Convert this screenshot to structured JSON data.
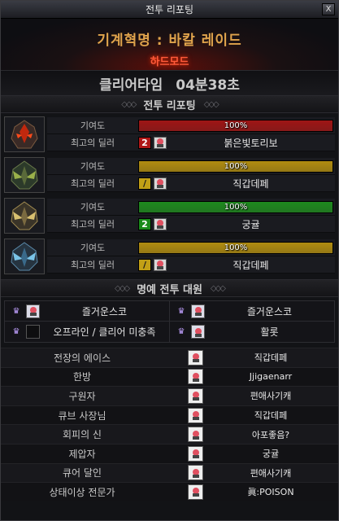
{
  "window": {
    "title": "전투 리포팅",
    "close_label": "X"
  },
  "raid": {
    "name": "기계혁명 : 바칼 레이드",
    "mode": "하드모드"
  },
  "clear_time": {
    "label": "클리어타임",
    "value": "04분38초"
  },
  "report_section": {
    "title": "전투 리포팅"
  },
  "reports": [
    {
      "portrait": "flame-mask-icon",
      "contribution_label": "기여도",
      "contribution_text": "100%",
      "contribution": 1.0,
      "bar_color": "#9e1515",
      "dealer_label": "최고의 딜러",
      "rank": "2",
      "rank_color": "#b01818",
      "rank_text_color": "#ffffff",
      "dealer_name": "붉은빛토리보"
    },
    {
      "portrait": "green-mask-icon",
      "contribution_label": "기여도",
      "contribution_text": "100%",
      "contribution": 1.0,
      "bar_color": "#b08c10",
      "dealer_label": "최고의 딜러",
      "rank": "/",
      "rank_color": "#c2a016",
      "rank_text_color": "#1a1a1a",
      "dealer_name": "직갑데페"
    },
    {
      "portrait": "gold-mask-icon",
      "contribution_label": "기여도",
      "contribution_text": "100%",
      "contribution": 1.0,
      "bar_color": "#1e8a1e",
      "dealer_label": "최고의 딜러",
      "rank": "2",
      "rank_color": "#1a8a1a",
      "rank_text_color": "#ffffff",
      "dealer_name": "궁귤"
    },
    {
      "portrait": "ice-mask-icon",
      "contribution_label": "기여도",
      "contribution_text": "100%",
      "contribution": 1.0,
      "bar_color": "#b08c10",
      "dealer_label": "최고의 딜러",
      "rank": "/",
      "rank_color": "#c2a016",
      "rank_text_color": "#1a1a1a",
      "dealer_name": "직갑데페"
    }
  ],
  "honor_section": {
    "title": "명예 전투 대원"
  },
  "honor": [
    [
      {
        "name": "즐거운스코",
        "empty": false
      },
      {
        "name": "즐거운스코",
        "empty": false
      }
    ],
    [
      {
        "name": "오프라인 / 클리어 미충족",
        "empty": true
      },
      {
        "name": "활롯",
        "empty": false
      }
    ]
  ],
  "awards": [
    {
      "title": "전장의 에이스",
      "name": "직갑데페"
    },
    {
      "title": "한방",
      "name": "Jjigaenarr"
    },
    {
      "title": "구원자",
      "name": "편애사기캐"
    },
    {
      "title": "큐브 사장님",
      "name": "직갑데페"
    },
    {
      "title": "회피의 신",
      "name": "아포좋음?"
    },
    {
      "title": "제압자",
      "name": "궁귤"
    },
    {
      "title": "큐어 달인",
      "name": "편애사기캐"
    },
    {
      "title": "상태이상 전문가",
      "name": "眞:POISON"
    }
  ],
  "section_deco": "◇◇◇",
  "crown_glyph": "♛"
}
